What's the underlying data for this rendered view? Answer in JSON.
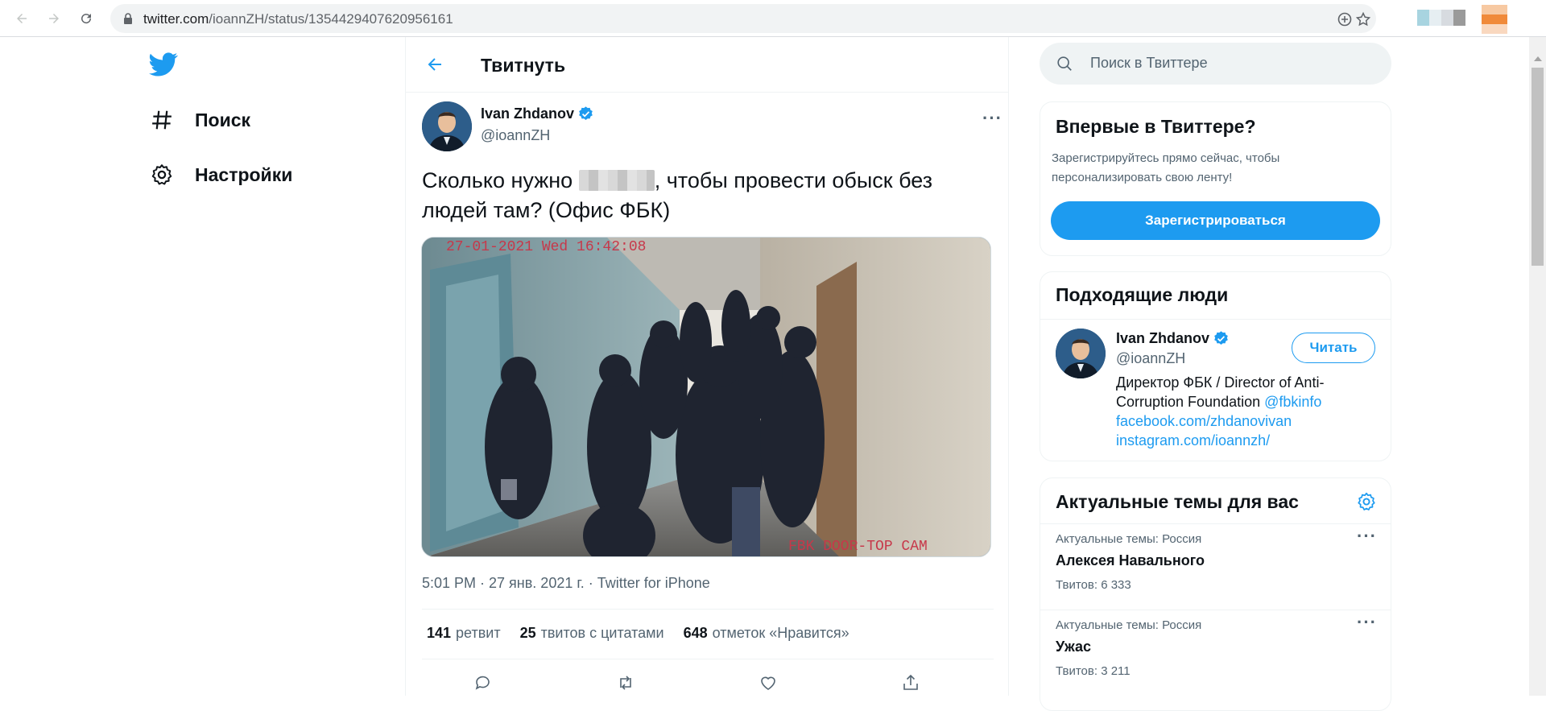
{
  "browser": {
    "url_host": "twitter.com",
    "url_path": "/ioannZH/status/1354429407620956161"
  },
  "sidebar": {
    "items": [
      {
        "label": "Поиск",
        "icon": "hash-icon"
      },
      {
        "label": "Настройки",
        "icon": "gear-icon"
      }
    ]
  },
  "header": {
    "title": "Твитнуть"
  },
  "tweet": {
    "author_name": "Ivan Zhdanov",
    "author_handle": "@ioannZH",
    "text_before": "Сколько нужно",
    "text_after": ", чтобы провести обыск без людей там? (Офис ФБК)",
    "media_overlay_top": "27-01-2021 Wed 16:42:08",
    "media_overlay_bottom": "FBK DOOR-TOP CAM",
    "timestamp": "5:01 PM · 27 янв. 2021 г. · Twitter for iPhone",
    "retweets_count": "141",
    "retweets_label": "ретвит",
    "quotes_count": "25",
    "quotes_label": "твитов с цитатами",
    "likes_count": "648",
    "likes_label": "отметок «Нравится»"
  },
  "search": {
    "placeholder": "Поиск в Твиттере"
  },
  "signup_card": {
    "title": "Впервые в Твиттере?",
    "text": "Зарегистрируйтесь прямо сейчас, чтобы персонализировать свою ленту!",
    "button": "Зарегистрироваться"
  },
  "people_card": {
    "title": "Подходящие люди",
    "name": "Ivan Zhdanov",
    "handle": "@ioannZH",
    "follow": "Читать",
    "bio_text": "Директор ФБК / Director of Anti-Corruption Foundation",
    "bio_mention": "@fbkinfo",
    "bio_link1": "facebook.com/zhdanovivan",
    "bio_link2": "instagram.com/ioannzh/"
  },
  "trends_card": {
    "title": "Актуальные темы для вас",
    "items": [
      {
        "meta": "Актуальные темы: Россия",
        "name": "Алексея Навального",
        "count": "Твитов: 6 333"
      },
      {
        "meta": "Актуальные темы: Россия",
        "name": "Ужас",
        "count": "Твитов: 3 211"
      }
    ]
  },
  "colors": {
    "accent": "#1d9bf0",
    "text": "#0f1419",
    "secondary": "#536471"
  }
}
